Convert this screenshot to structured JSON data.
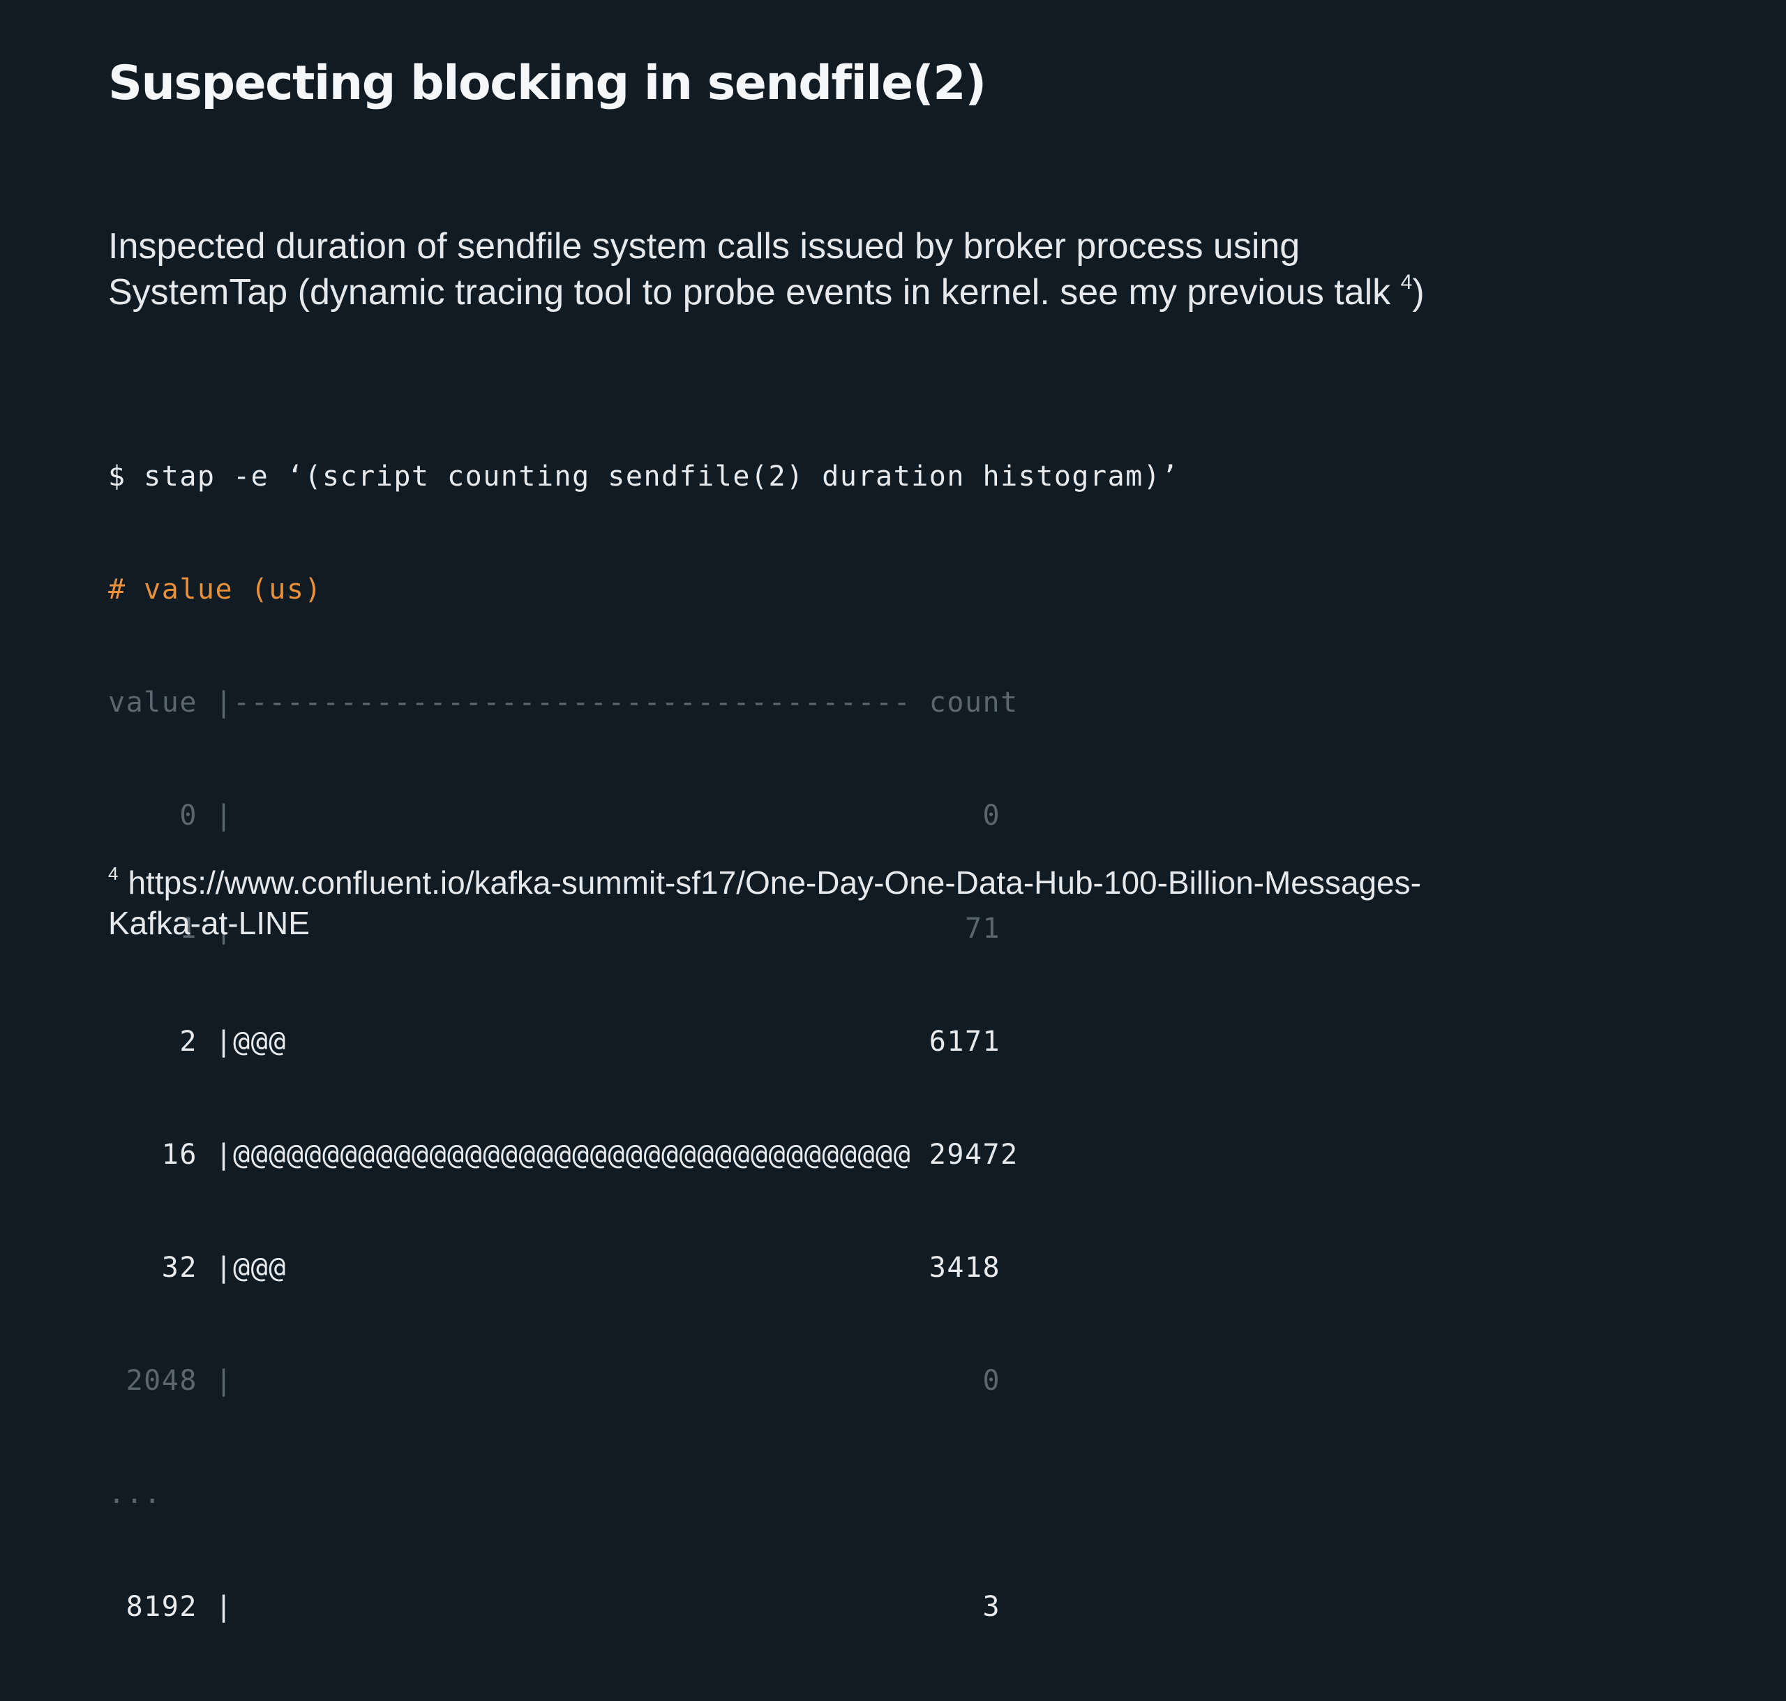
{
  "slide": {
    "title": "Suspecting blocking in sendfile(2)",
    "body_line1": "Inspected duration of sendfile system calls issued by broker process using",
    "body_line2": "SystemTap (dynamic tracing tool to probe events in kernel. see my previous talk ",
    "body_ref": "4",
    "body_close": ")",
    "code": {
      "command": "$ stap -e ‘(script counting sendfile(2) duration histogram)’",
      "comment": "# value (us)",
      "header": "value |-------------------------------------- count",
      "rows": [
        {
          "text": "    0 |                                          0",
          "emphasis": "dim"
        },
        {
          "text": "    1 |                                         71",
          "emphasis": "dim"
        },
        {
          "text": "    2 |@@@                                    6171",
          "emphasis": "bright"
        },
        {
          "text": "   16 |@@@@@@@@@@@@@@@@@@@@@@@@@@@@@@@@@@@@@@ 29472",
          "emphasis": "bright"
        },
        {
          "text": "   32 |@@@                                    3418",
          "emphasis": "bright"
        },
        {
          "text": " 2048 |                                          0",
          "emphasis": "dim"
        }
      ],
      "ellipsis": "...",
      "last_row": " 8192 |                                          3"
    },
    "footnote": {
      "mark": "4",
      "line1": "https://www.confluent.io/kafka-summit-sf17/One-Day-One-Data-Hub-100-Billion-Messages-",
      "line2": "Kafka-at-LINE"
    }
  },
  "colors": {
    "background": "#101b23",
    "text": "#e8ebee",
    "comment": "#e8903a",
    "dim": "#5b666f"
  }
}
